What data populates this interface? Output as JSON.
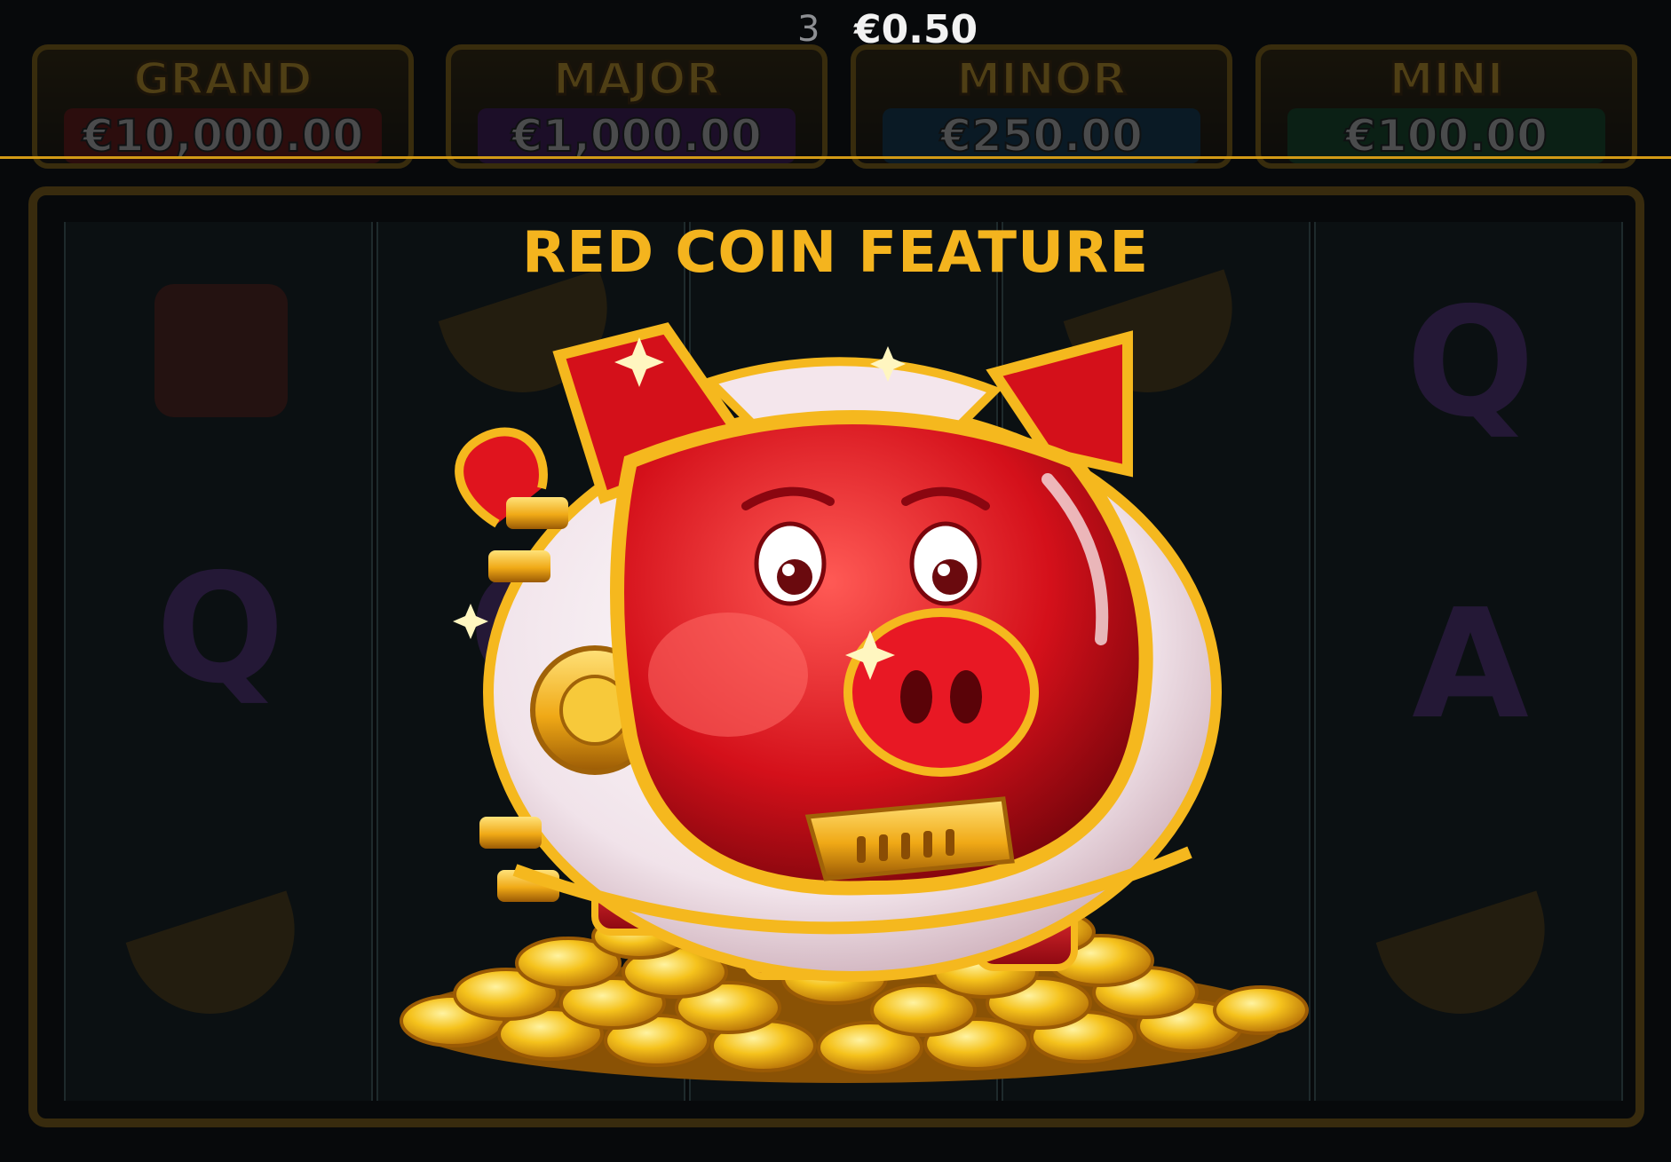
{
  "status": {
    "count": "3",
    "balance": "€0.50"
  },
  "jackpots": [
    {
      "name": "GRAND",
      "value": "€10,000.00",
      "color": "#c4261f"
    },
    {
      "name": "MAJOR",
      "value": "€1,000.00",
      "color": "#7a2aa8"
    },
    {
      "name": "MINOR",
      "value": "€250.00",
      "color": "#1f7fb8"
    },
    {
      "name": "MINI",
      "value": "€100.00",
      "color": "#2aa04a"
    }
  ],
  "feature": {
    "title": "RED COIN FEATURE",
    "icon": "astronaut-piggy-bank-icon"
  },
  "reels": {
    "symbols": [
      "radio-icon",
      "Q",
      "satellite-dish-icon",
      "satellite-dish-icon",
      "Q",
      "satellite-dish-icon",
      "Q",
      "A",
      "satellite-dish-icon"
    ]
  },
  "colors": {
    "title": "#f4b41e",
    "accent_gold": "#d29a16",
    "pig_red": "#d4101a"
  }
}
